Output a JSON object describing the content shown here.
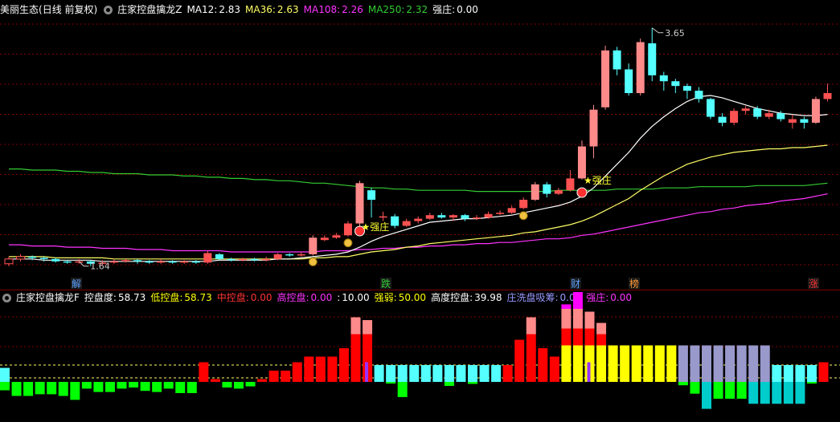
{
  "main_header": {
    "stock_name": "美丽生态",
    "period_info": "(日线 前复权)",
    "indicator_name": "庄家控盘擒龙Z",
    "ma12_label": "MA12:",
    "ma12_value": "2.83",
    "ma36_label": "MA36:",
    "ma36_value": "2.63",
    "ma108_label": "MA108:",
    "ma108_value": "2.26",
    "ma250_label": "MA250:",
    "ma250_value": "2.32",
    "strong_label": "强庄:",
    "strong_value": "0.00"
  },
  "sub_header": {
    "indicator_name": "庄家控盘擒龙F",
    "control_label": "控盘度:",
    "control_value": "58.73",
    "low_label": "低控盘:",
    "low_value": "58.73",
    "mid_label": "中控盘:",
    "mid_value": "0.00",
    "high_label": "高控盘:",
    "high_value": "0.00",
    "extra_label": ":",
    "extra_value": "10.00",
    "strength_label": "强弱:",
    "strength_value": "50.00",
    "highlevel_label": "高度控盘:",
    "highlevel_value": "39.98",
    "wash_label": "庄洗盘吸筹:",
    "wash_value": "0.00",
    "strong_label": "强庄:",
    "strong_value": "0.00"
  },
  "colors": {
    "up": "#ff5252",
    "up_hollow": "#ff8a8a",
    "down": "#54ffff",
    "ma12": "#ffffff",
    "ma36": "#ffff66",
    "ma108": "#ff33ff",
    "ma250": "#33cc33",
    "grid": "#800000"
  },
  "annotations": {
    "high_price": "3.65",
    "low_price": "1.64",
    "signal1": "★强庄",
    "signal2": "★强庄"
  },
  "event_tags": [
    {
      "text": "解",
      "color": "#5aa0ff"
    },
    {
      "text": "跌",
      "color": "#33cc33"
    },
    {
      "text": "财",
      "color": "#5aa0ff"
    },
    {
      "text": "榜",
      "color": "#ff9933"
    },
    {
      "text": "涨",
      "color": "#ff3333"
    }
  ],
  "chart_data": [
    {
      "type": "candlestick",
      "price_range": [
        1.55,
        3.75
      ],
      "candles": [
        [
          1.66,
          1.7,
          1.72,
          1.64
        ],
        [
          1.7,
          1.72,
          1.74,
          1.68
        ],
        [
          1.72,
          1.71,
          1.73,
          1.69
        ],
        [
          1.71,
          1.7,
          1.72,
          1.68
        ],
        [
          1.7,
          1.68,
          1.71,
          1.67
        ],
        [
          1.68,
          1.67,
          1.69,
          1.66
        ],
        [
          1.67,
          1.68,
          1.7,
          1.66
        ],
        [
          1.68,
          1.66,
          1.69,
          1.64
        ],
        [
          1.66,
          1.67,
          1.69,
          1.65
        ],
        [
          1.67,
          1.68,
          1.7,
          1.66
        ],
        [
          1.68,
          1.69,
          1.7,
          1.67
        ],
        [
          1.69,
          1.68,
          1.7,
          1.66
        ],
        [
          1.68,
          1.67,
          1.69,
          1.66
        ],
        [
          1.67,
          1.68,
          1.7,
          1.66
        ],
        [
          1.68,
          1.67,
          1.69,
          1.66
        ],
        [
          1.67,
          1.68,
          1.69,
          1.66
        ],
        [
          1.68,
          1.67,
          1.69,
          1.66
        ],
        [
          1.67,
          1.75,
          1.77,
          1.66
        ],
        [
          1.74,
          1.7,
          1.75,
          1.69
        ],
        [
          1.7,
          1.69,
          1.71,
          1.68
        ],
        [
          1.69,
          1.7,
          1.71,
          1.68
        ],
        [
          1.7,
          1.69,
          1.71,
          1.68
        ],
        [
          1.69,
          1.7,
          1.72,
          1.68
        ],
        [
          1.7,
          1.74,
          1.75,
          1.69
        ],
        [
          1.74,
          1.73,
          1.75,
          1.72
        ],
        [
          1.73,
          1.74,
          1.76,
          1.72
        ],
        [
          1.74,
          1.88,
          1.9,
          1.73
        ],
        [
          1.86,
          1.88,
          1.9,
          1.85
        ],
        [
          1.88,
          1.9,
          1.92,
          1.87
        ],
        [
          1.9,
          2.0,
          2.02,
          1.89
        ],
        [
          2.0,
          2.34,
          2.36,
          1.98
        ],
        [
          2.28,
          2.2,
          2.3,
          2.05
        ],
        [
          2.05,
          2.06,
          2.1,
          2.02
        ],
        [
          2.06,
          1.98,
          2.08,
          1.96
        ],
        [
          1.98,
          2.02,
          2.04,
          1.97
        ],
        [
          2.02,
          2.04,
          2.06,
          2.0
        ],
        [
          2.04,
          2.07,
          2.09,
          2.03
        ],
        [
          2.07,
          2.05,
          2.09,
          2.04
        ],
        [
          2.05,
          2.07,
          2.08,
          2.02
        ],
        [
          2.07,
          2.04,
          2.08,
          2.02
        ],
        [
          2.04,
          2.05,
          2.07,
          2.03
        ],
        [
          2.05,
          2.08,
          2.1,
          2.04
        ],
        [
          2.08,
          2.09,
          2.11,
          2.07
        ],
        [
          2.09,
          2.13,
          2.15,
          2.08
        ],
        [
          2.13,
          2.2,
          2.22,
          2.12
        ],
        [
          2.2,
          2.33,
          2.35,
          2.19
        ],
        [
          2.33,
          2.25,
          2.35,
          2.22
        ],
        [
          2.25,
          2.28,
          2.3,
          2.24
        ],
        [
          2.28,
          2.38,
          2.45,
          2.27
        ],
        [
          2.38,
          2.65,
          2.7,
          2.37
        ],
        [
          2.65,
          2.96,
          3.0,
          2.55
        ],
        [
          2.98,
          3.46,
          3.5,
          2.96
        ],
        [
          3.46,
          3.3,
          3.49,
          3.25
        ],
        [
          3.3,
          3.1,
          3.35,
          3.08
        ],
        [
          3.1,
          3.53,
          3.56,
          3.08
        ],
        [
          3.52,
          3.25,
          3.65,
          3.2
        ],
        [
          3.25,
          3.2,
          3.28,
          3.12
        ],
        [
          3.2,
          3.16,
          3.22,
          3.1
        ],
        [
          3.16,
          3.12,
          3.18,
          3.05
        ],
        [
          3.12,
          3.05,
          3.15,
          3.02
        ],
        [
          3.05,
          2.9,
          3.06,
          2.88
        ],
        [
          2.9,
          2.85,
          2.93,
          2.82
        ],
        [
          2.85,
          2.95,
          2.97,
          2.83
        ],
        [
          2.95,
          2.97,
          2.99,
          2.92
        ],
        [
          2.97,
          2.9,
          2.99,
          2.88
        ],
        [
          2.9,
          2.93,
          2.96,
          2.88
        ],
        [
          2.93,
          2.88,
          2.95,
          2.86
        ],
        [
          2.85,
          2.88,
          2.92,
          2.8
        ],
        [
          2.88,
          2.85,
          2.9,
          2.8
        ],
        [
          2.85,
          3.05,
          3.07,
          2.84
        ],
        [
          3.05,
          3.1,
          3.18,
          3.03
        ]
      ],
      "ma_lines": {
        "ma12": [
          1.7,
          1.7,
          1.7,
          1.69,
          1.69,
          1.69,
          1.69,
          1.69,
          1.68,
          1.68,
          1.68,
          1.68,
          1.68,
          1.68,
          1.68,
          1.68,
          1.68,
          1.68,
          1.69,
          1.69,
          1.69,
          1.69,
          1.69,
          1.7,
          1.7,
          1.71,
          1.72,
          1.73,
          1.74,
          1.76,
          1.8,
          1.85,
          1.89,
          1.92,
          1.95,
          1.98,
          2.01,
          2.02,
          2.03,
          2.04,
          2.04,
          2.05,
          2.06,
          2.07,
          2.09,
          2.11,
          2.13,
          2.15,
          2.18,
          2.23,
          2.3,
          2.4,
          2.5,
          2.6,
          2.72,
          2.82,
          2.9,
          2.97,
          3.03,
          3.07,
          3.08,
          3.06,
          3.03,
          3.0,
          2.97,
          2.95,
          2.93,
          2.92,
          2.91,
          2.91,
          2.92
        ],
        "ma36": [
          1.72,
          1.72,
          1.72,
          1.72,
          1.71,
          1.71,
          1.71,
          1.71,
          1.71,
          1.7,
          1.7,
          1.7,
          1.7,
          1.7,
          1.7,
          1.7,
          1.7,
          1.7,
          1.7,
          1.7,
          1.7,
          1.7,
          1.7,
          1.7,
          1.7,
          1.7,
          1.71,
          1.71,
          1.72,
          1.72,
          1.74,
          1.76,
          1.77,
          1.78,
          1.8,
          1.81,
          1.83,
          1.84,
          1.85,
          1.86,
          1.87,
          1.88,
          1.89,
          1.9,
          1.92,
          1.93,
          1.95,
          1.97,
          1.99,
          2.02,
          2.06,
          2.11,
          2.16,
          2.21,
          2.28,
          2.34,
          2.4,
          2.45,
          2.5,
          2.53,
          2.56,
          2.58,
          2.6,
          2.61,
          2.62,
          2.63,
          2.63,
          2.64,
          2.64,
          2.65,
          2.66
        ],
        "ma108": [
          1.82,
          1.82,
          1.81,
          1.81,
          1.81,
          1.8,
          1.8,
          1.8,
          1.79,
          1.79,
          1.79,
          1.78,
          1.78,
          1.78,
          1.77,
          1.77,
          1.77,
          1.77,
          1.77,
          1.76,
          1.76,
          1.76,
          1.76,
          1.76,
          1.76,
          1.76,
          1.76,
          1.77,
          1.77,
          1.77,
          1.78,
          1.78,
          1.79,
          1.79,
          1.8,
          1.8,
          1.81,
          1.81,
          1.82,
          1.82,
          1.83,
          1.83,
          1.84,
          1.84,
          1.85,
          1.86,
          1.87,
          1.87,
          1.88,
          1.9,
          1.91,
          1.93,
          1.95,
          1.97,
          1.99,
          2.01,
          2.03,
          2.05,
          2.07,
          2.09,
          2.1,
          2.12,
          2.13,
          2.15,
          2.16,
          2.17,
          2.19,
          2.2,
          2.21,
          2.23,
          2.25
        ],
        "ma250": [
          2.46,
          2.46,
          2.45,
          2.45,
          2.45,
          2.44,
          2.44,
          2.43,
          2.43,
          2.42,
          2.42,
          2.42,
          2.41,
          2.41,
          2.41,
          2.4,
          2.4,
          2.39,
          2.39,
          2.38,
          2.38,
          2.37,
          2.37,
          2.36,
          2.36,
          2.35,
          2.34,
          2.34,
          2.33,
          2.32,
          2.31,
          2.3,
          2.3,
          2.29,
          2.29,
          2.28,
          2.28,
          2.28,
          2.28,
          2.28,
          2.27,
          2.27,
          2.27,
          2.27,
          2.27,
          2.27,
          2.27,
          2.28,
          2.28,
          2.28,
          2.28,
          2.28,
          2.29,
          2.29,
          2.29,
          2.29,
          2.3,
          2.3,
          2.3,
          2.31,
          2.31,
          2.31,
          2.31,
          2.31,
          2.32,
          2.32,
          2.32,
          2.32,
          2.32,
          2.33,
          2.34
        ]
      }
    },
    {
      "type": "bar",
      "value_range": [
        -1,
        1
      ],
      "bars": [
        {
          "c": "#54ffff",
          "v": 0.25,
          "n": -0.25
        },
        {
          "c": "#00ff00",
          "v": -0.25
        },
        {
          "c": "#00ff00",
          "v": -0.25
        },
        {
          "c": "#00ff00",
          "v": -0.22
        },
        {
          "c": "#00ff00",
          "v": -0.22
        },
        {
          "c": "#00ff00",
          "v": -0.25
        },
        {
          "c": "#00ff00",
          "v": -0.32
        },
        {
          "c": "#00ff00",
          "v": -0.12
        },
        {
          "c": "#00ff00",
          "v": -0.18
        },
        {
          "c": "#00ff00",
          "v": -0.18
        },
        {
          "c": "#00ff00",
          "v": -0.12
        },
        {
          "c": "#00ff00",
          "v": -0.1
        },
        {
          "c": "#00ff00",
          "v": -0.16
        },
        {
          "c": "#00ff00",
          "v": -0.18
        },
        {
          "c": "#00ff00",
          "v": -0.12
        },
        {
          "c": "#00ff00",
          "v": -0.2
        },
        {
          "c": "#00ff00",
          "v": -0.2
        },
        {
          "c": "#ff0000",
          "v": 0.35
        },
        {
          "c": "#ff0000",
          "v": 0.05
        },
        {
          "c": "#00ff00",
          "v": -0.1
        },
        {
          "c": "#00ff00",
          "v": -0.12
        },
        {
          "c": "#00ff00",
          "v": -0.08
        },
        {
          "c": "#ff0000",
          "v": 0.05
        },
        {
          "c": "#ff0000",
          "v": 0.2
        },
        {
          "c": "#ff0000",
          "v": 0.2
        },
        {
          "c": "#ff0000",
          "v": 0.35
        },
        {
          "c": "#ff0000",
          "v": 0.45
        },
        {
          "c": "#ff0000",
          "v": 0.45
        },
        {
          "c": "#ff0000",
          "v": 0.45
        },
        {
          "c": "#ff0000",
          "v": 0.6
        },
        {
          "c": "#ff0000",
          "v": 0.85,
          "t": "#ff8a8a",
          "tv": 0.3
        },
        {
          "c": "#ff0000",
          "v": 0.85,
          "t": "#ff8a8a",
          "tv": 0.25
        },
        {
          "c": "#54ffff",
          "v": 0.3
        },
        {
          "c": "#54ffff",
          "v": 0.3,
          "n": -0.05
        },
        {
          "c": "#54ffff",
          "v": 0.3,
          "n": -0.45
        },
        {
          "c": "#54ffff",
          "v": 0.3
        },
        {
          "c": "#54ffff",
          "v": 0.3
        },
        {
          "c": "#54ffff",
          "v": 0.3
        },
        {
          "c": "#54ffff",
          "v": 0.3,
          "n": -0.12
        },
        {
          "c": "#54ffff",
          "v": 0.3
        },
        {
          "c": "#54ffff",
          "v": 0.3,
          "n": -0.06
        },
        {
          "c": "#54ffff",
          "v": 0.3
        },
        {
          "c": "#54ffff",
          "v": 0.3
        },
        {
          "c": "#ff0000",
          "v": 0.3
        },
        {
          "c": "#ff0000",
          "v": 0.75
        },
        {
          "c": "#ff0000",
          "v": 0.85,
          "t": "#ff8a8a",
          "tv": 0.3
        },
        {
          "c": "#ff0000",
          "v": 0.6
        },
        {
          "c": "#ff0000",
          "v": 0.45
        },
        {
          "c": "#ffff00",
          "v": 0.65,
          "t": "#ff0000",
          "tv": 0.3,
          "t2": "#ff8a8a",
          "t2v": 0.35,
          "t3": "#ff00ff",
          "t3v": 0.08
        },
        {
          "c": "#ffff00",
          "v": 0.65,
          "t": "#ff0000",
          "tv": 0.3,
          "t2": "#ff8a8a",
          "t2v": 0.35,
          "t3": "#ff00ff",
          "t3v": 0.3
        },
        {
          "c": "#ffff00",
          "v": 0.65,
          "t": "#ff0000",
          "tv": 0.3,
          "t2": "#ff8a8a",
          "t2v": 0.3
        },
        {
          "c": "#ffff00",
          "v": 0.65,
          "t": "#ff0000",
          "tv": 0.2,
          "t2": "#ff8a8a",
          "t2v": 0.2
        },
        {
          "c": "#ffff00",
          "v": 0.65
        },
        {
          "c": "#ffff00",
          "v": 0.65
        },
        {
          "c": "#ffff00",
          "v": 0.65
        },
        {
          "c": "#ffff00",
          "v": 0.65
        },
        {
          "c": "#ffff00",
          "v": 0.65
        },
        {
          "c": "#ffff00",
          "v": 0.65
        },
        {
          "c": "#9999cc",
          "v": 0.65,
          "n": -0.1
        },
        {
          "c": "#9999cc",
          "v": 0.65,
          "n": -0.35
        },
        {
          "c": "#9999cc",
          "v": 0.65,
          "n": -0.8
        },
        {
          "c": "#9999cc",
          "v": 0.65,
          "n": -0.5
        },
        {
          "c": "#9999cc",
          "v": 0.65,
          "n": -0.5
        },
        {
          "c": "#9999cc",
          "v": 0.65,
          "n": -0.5
        },
        {
          "c": "#9999cc",
          "v": 0.65,
          "n": -0.65
        },
        {
          "c": "#9999cc",
          "v": 0.65,
          "n": -0.65
        },
        {
          "c": "#54ffff",
          "v": 0.3,
          "n": -0.65
        },
        {
          "c": "#54ffff",
          "v": 0.3,
          "n": -0.65
        },
        {
          "c": "#54ffff",
          "v": 0.3,
          "n": -0.65
        },
        {
          "c": "#54ffff",
          "v": 0.3,
          "n": -0.05
        },
        {
          "c": "#ff0000",
          "v": 0.35
        }
      ]
    }
  ]
}
